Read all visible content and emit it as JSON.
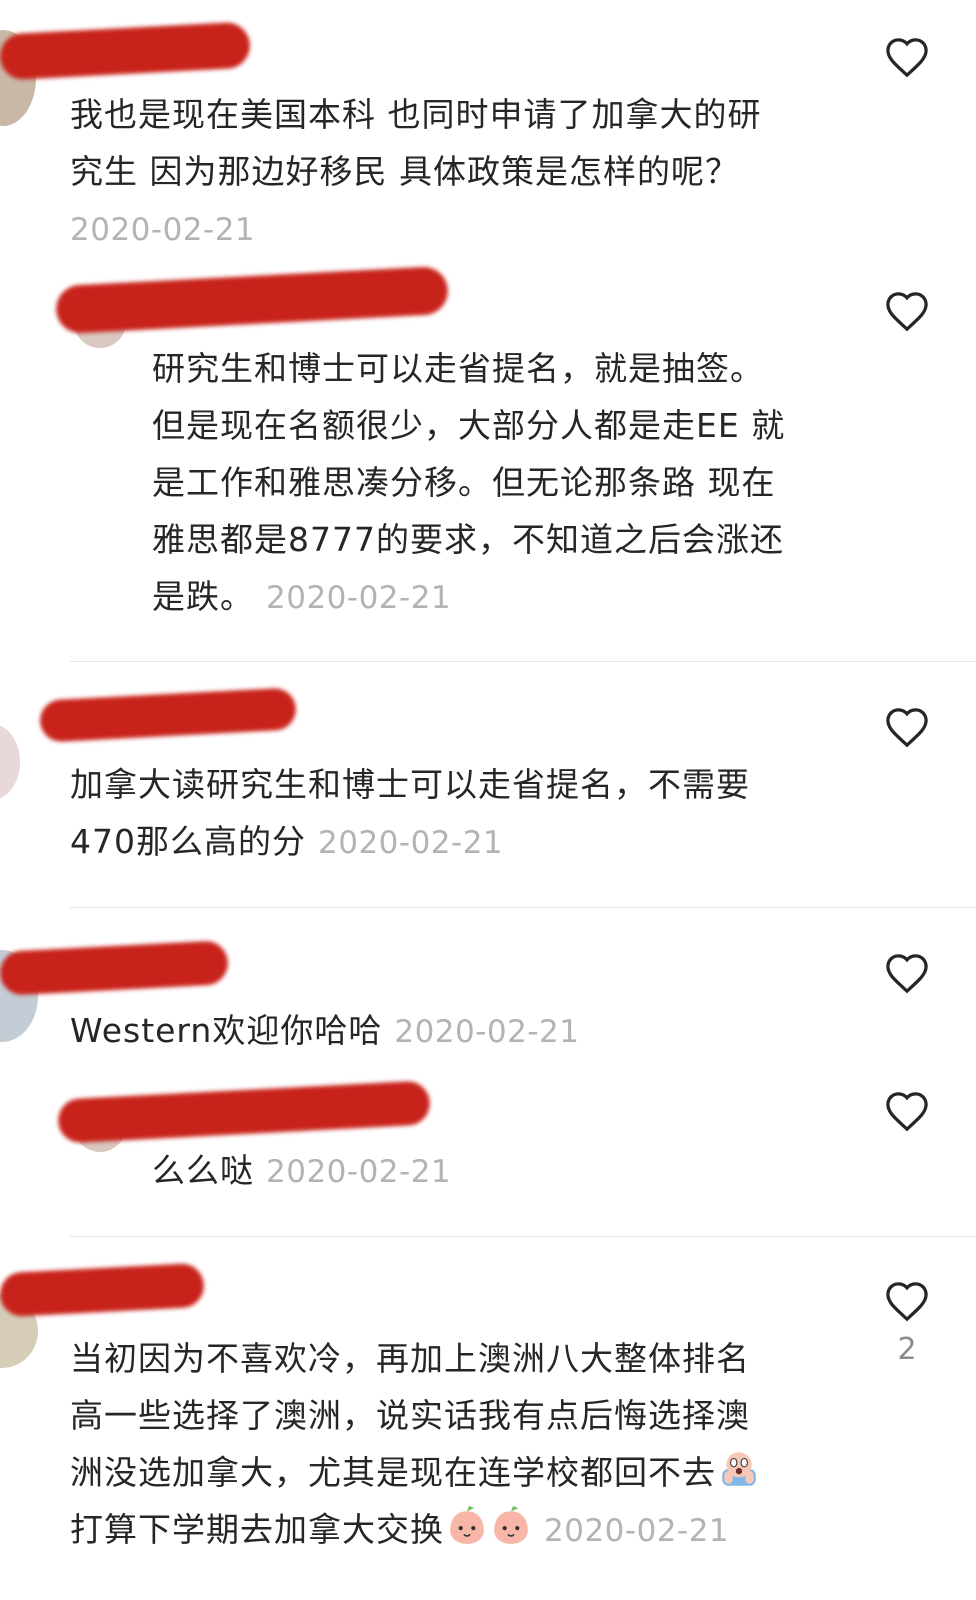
{
  "comments": [
    {
      "text_lines": [
        "我也是现在美国本科 也同时申请了加拿大的研",
        "究生 因为那边好移民 具体政策是怎样的呢？"
      ],
      "date": "2020-02-21"
    },
    {
      "text_lines": [
        "研究生和博士可以走省提名，就是抽签。",
        "但是现在名额很少，大部分人都是走EE 就",
        "是工作和雅思凑分移。但无论那条路 现在",
        "雅思都是8777的要求，不知道之后会涨还",
        "是跌。"
      ],
      "date": "2020-02-21"
    },
    {
      "text_lines": [
        "加拿大读研究生和博士可以走省提名，不需要",
        "470那么高的分"
      ],
      "date": "2020-02-21"
    },
    {
      "text_lines": [
        "Western欢迎你哈哈"
      ],
      "date": "2020-02-21"
    },
    {
      "text_lines": [
        "么么哒"
      ],
      "date": "2020-02-21"
    },
    {
      "text_lines": [
        "当初因为不喜欢冷，再加上澳洲八大整体排名",
        "高一些选择了澳洲，说实话我有点后悔选择澳",
        "洲没选加拿大，尤其是现在连学校都回不去",
        "打算下学期去加拿大交换"
      ],
      "date": "2020-02-21",
      "likes": "2"
    }
  ],
  "icons": {
    "like": "heart-outline-icon",
    "emoji_scared": "scream-emoji-icon",
    "emoji_peach": "peach-face-emoji-icon"
  },
  "colors": {
    "redaction": "#c8231b",
    "date": "#b3b3b3",
    "text": "#262626"
  }
}
